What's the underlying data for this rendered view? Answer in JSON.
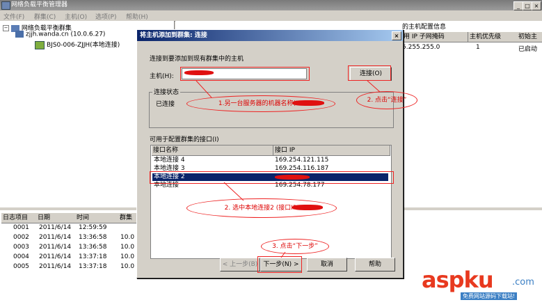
{
  "window": {
    "title": "网络负载平衡管理器",
    "controls": [
      "_",
      "□",
      "×"
    ]
  },
  "menu": [
    "文件(F)",
    "群集(C)",
    "主机(O)",
    "选项(P)",
    "帮助(H)"
  ],
  "tree": {
    "root": "网络负载平衡群集",
    "host": "zjjh.wanda.cn (10.0.6.27)",
    "iface": "BJS0-006-ZJJH(本地连接)"
  },
  "right_pane": {
    "caption_partial": "在群集 zjjh.wanda.cn (10.0.6.27) 的主机配置信息",
    "headers": [
      "用 IP 子网掩码",
      "主机优先级",
      "初始主"
    ],
    "row": [
      "5.255.255.0",
      "1",
      "已启动"
    ]
  },
  "log": {
    "headers": [
      "日志项目",
      "日期",
      "时间",
      "群集"
    ],
    "rows": [
      [
        "0001",
        "2011/6/14",
        "12:59:59",
        ""
      ],
      [
        "0002",
        "2011/6/14",
        "13:36:58",
        "10.0"
      ],
      [
        "0003",
        "2011/6/14",
        "13:36:58",
        "10.0"
      ],
      [
        "0004",
        "2011/6/14",
        "13:37:18",
        "10.0"
      ],
      [
        "0005",
        "2011/6/14",
        "13:37:18",
        "10.0"
      ]
    ]
  },
  "dialog": {
    "title": "将主机添加到群集: 连接",
    "close": "×",
    "intro": "连接到要添加到现有群集中的主机",
    "host_label": "主机(H):",
    "host_value": "",
    "connect_button": "连接(O)",
    "status_group": "连接状态",
    "status_value": "已连接",
    "list_label": "可用于配置群集的接口(I)",
    "list_headers": [
      "接口名称",
      "接口 IP"
    ],
    "interfaces": [
      {
        "name": "本地连接 4",
        "ip": "169.254.121.115"
      },
      {
        "name": "本地连接 3",
        "ip": "169.254.116.187"
      },
      {
        "name": "本地连接 2",
        "ip": ""
      },
      {
        "name": "本地连接",
        "ip": "169.254.78.177"
      }
    ],
    "buttons": {
      "back": "< 上一步(B)",
      "next": "下一步(N) >",
      "cancel": "取消",
      "help": "帮助"
    }
  },
  "annotations": {
    "a1": "1.另一台服务器的机器名称(IP:",
    "a2": "2. 点击“连接”",
    "a3": "2. 选中本地连接2 (接口IP:",
    "a4": "3. 点击“下一步”"
  },
  "watermark": {
    "brand": "aspku",
    "tld": ".com",
    "tagline": "免费网站源码下载站!"
  },
  "colors": {
    "dialog_title": "#0a246a",
    "annotation": "#e22222",
    "watermark_red": "#e8391f",
    "watermark_blue": "#3b7fc4"
  }
}
